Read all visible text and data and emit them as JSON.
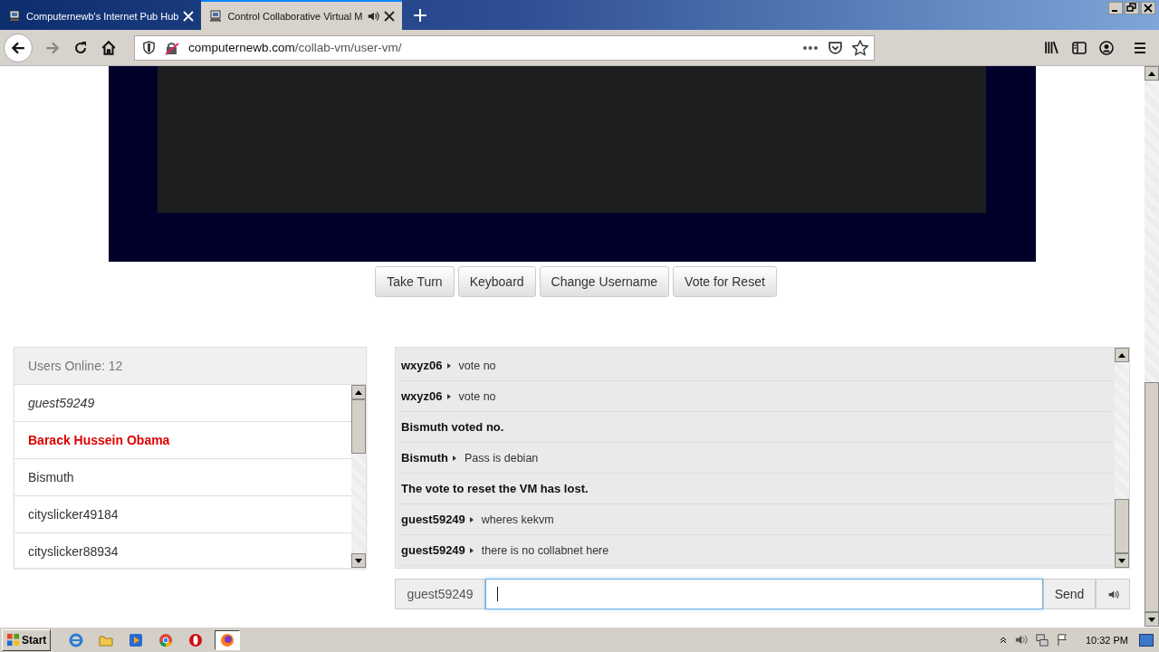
{
  "tabs": [
    {
      "title": "Computernewb's Internet Pub Hub",
      "selected": false,
      "audio": false
    },
    {
      "title": "Control Collaborative Virtual M",
      "selected": true,
      "audio": true
    }
  ],
  "address_bar": {
    "domain": "computernewb.com",
    "path": "/collab-vm/user-vm/"
  },
  "vm_buttons": [
    "Take Turn",
    "Keyboard",
    "Change Username",
    "Vote for Reset"
  ],
  "users_panel": {
    "header": "Users Online: 12",
    "users": [
      {
        "name": "guest59249",
        "kind": "self"
      },
      {
        "name": "Barack Hussein Obama",
        "kind": "admin"
      },
      {
        "name": "Bismuth",
        "kind": "user"
      },
      {
        "name": "cityslicker49184",
        "kind": "user"
      },
      {
        "name": "cityslicker88934",
        "kind": "user"
      }
    ]
  },
  "chat": {
    "messages": [
      {
        "kind": "chat",
        "user": "wxyz06",
        "text": "vote no"
      },
      {
        "kind": "chat",
        "user": "wxyz06",
        "text": "vote no"
      },
      {
        "kind": "notice",
        "text": "Bismuth voted no."
      },
      {
        "kind": "chat",
        "user": "Bismuth",
        "text": "Pass is debian"
      },
      {
        "kind": "notice",
        "text": "The vote to reset the VM has lost."
      },
      {
        "kind": "chat",
        "user": "guest59249",
        "text": "wheres kekvm"
      },
      {
        "kind": "chat",
        "user": "guest59249",
        "text": "there is no collabnet here"
      }
    ],
    "username": "guest59249",
    "send_button": "Send"
  },
  "taskbar": {
    "start": "Start",
    "items": [
      {
        "selected": false
      },
      {
        "selected": false
      },
      {
        "selected": false
      },
      {
        "selected": false
      },
      {
        "selected": false
      },
      {
        "selected": true
      }
    ],
    "clock": "10:32 PM"
  }
}
